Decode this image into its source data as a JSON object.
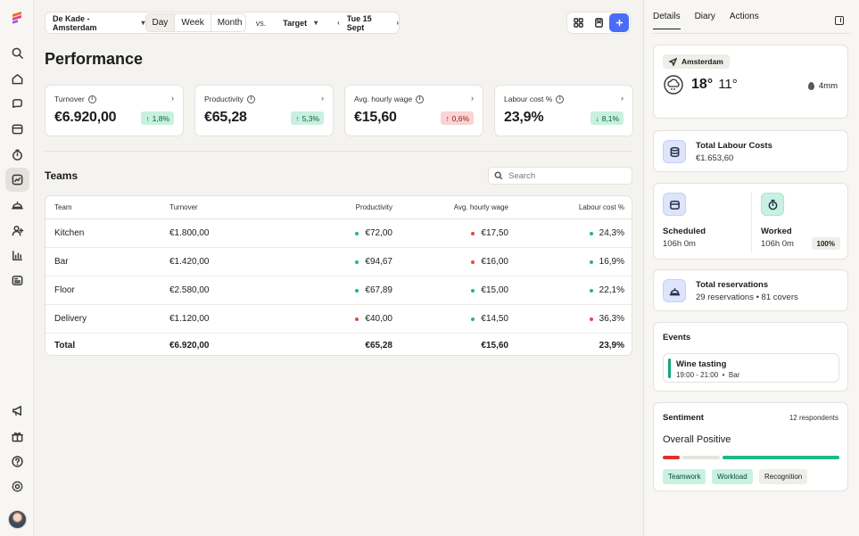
{
  "toolbar": {
    "location": "De Kade - Amsterdam",
    "periods": [
      "Day",
      "Week",
      "Month"
    ],
    "selected_period": "Day",
    "vs_label": "vs.",
    "compare_target": "Target",
    "date": "Tue 15 Sept"
  },
  "page_title": "Performance",
  "kpis": [
    {
      "label": "Turnover",
      "value": "€6.920,00",
      "delta": "1,8%",
      "direction": "up",
      "status": "positive"
    },
    {
      "label": "Productivity",
      "value": "€65,28",
      "delta": "5,3%",
      "direction": "up",
      "status": "positive"
    },
    {
      "label": "Avg. hourly wage",
      "value": "€15,60",
      "delta": "0,6%",
      "direction": "up",
      "status": "negative"
    },
    {
      "label": "Labour cost %",
      "value": "23,9%",
      "delta": "8,1%",
      "direction": "down",
      "status": "positive"
    }
  ],
  "teams": {
    "title": "Teams",
    "search_placeholder": "Search",
    "columns": [
      "Team",
      "Turnover",
      "Productivity",
      "Avg. hourly wage",
      "Labour cost %"
    ],
    "rows": [
      {
        "team": "Kitchen",
        "turnover": "€1.800,00",
        "productivity": "€72,00",
        "prod_status": "green",
        "wage": "€17,50",
        "wage_status": "red",
        "labour": "24,3%",
        "labour_status": "green"
      },
      {
        "team": "Bar",
        "turnover": "€1.420,00",
        "productivity": "€94,67",
        "prod_status": "green",
        "wage": "€16,00",
        "wage_status": "red",
        "labour": "16,9%",
        "labour_status": "green"
      },
      {
        "team": "Floor",
        "turnover": "€2.580,00",
        "productivity": "€67,89",
        "prod_status": "green",
        "wage": "€15,00",
        "wage_status": "green",
        "labour": "22,1%",
        "labour_status": "green"
      },
      {
        "team": "Delivery",
        "turnover": "€1.120,00",
        "productivity": "€40,00",
        "prod_status": "red",
        "wage": "€14,50",
        "wage_status": "green",
        "labour": "36,3%",
        "labour_status": "red"
      }
    ],
    "total": {
      "label": "Total",
      "turnover": "€6.920,00",
      "productivity": "€65,28",
      "wage": "€15,60",
      "labour": "23,9%"
    }
  },
  "side_panel": {
    "tabs": [
      "Details",
      "Diary",
      "Actions"
    ],
    "active_tab": "Details",
    "weather": {
      "city": "Amsterdam",
      "high": "18°",
      "low": "11°",
      "rain": "4mm"
    },
    "labour_costs": {
      "title": "Total Labour Costs",
      "value": "€1.653,60"
    },
    "scheduled": {
      "title": "Scheduled",
      "value": "106h 0m"
    },
    "worked": {
      "title": "Worked",
      "value": "106h 0m",
      "percent": "100%"
    },
    "reservations": {
      "title": "Total reservations",
      "value": "29 reservations • 81 covers"
    },
    "events": {
      "title": "Events",
      "items": [
        {
          "name": "Wine tasting",
          "time": "19:00 - 21:00",
          "sep": "•",
          "place": "Bar"
        }
      ]
    },
    "sentiment": {
      "title": "Sentiment",
      "respondents": "12 respondents",
      "overall": "Overall Positive",
      "bar_segments": [
        {
          "share": 0.1,
          "color": "#d9332b"
        },
        {
          "share": 0.22,
          "color": "#e6e4de"
        },
        {
          "share": 0.68,
          "color": "#1eb980"
        }
      ],
      "tags": [
        {
          "label": "Teamwork",
          "tone": "positive"
        },
        {
          "label": "Workload",
          "tone": "positive"
        },
        {
          "label": "Recognition",
          "tone": "neutral"
        }
      ]
    }
  },
  "colors": {
    "accent": "#4a6cf7",
    "positive": "#1eb980",
    "negative": "#e5483c"
  }
}
